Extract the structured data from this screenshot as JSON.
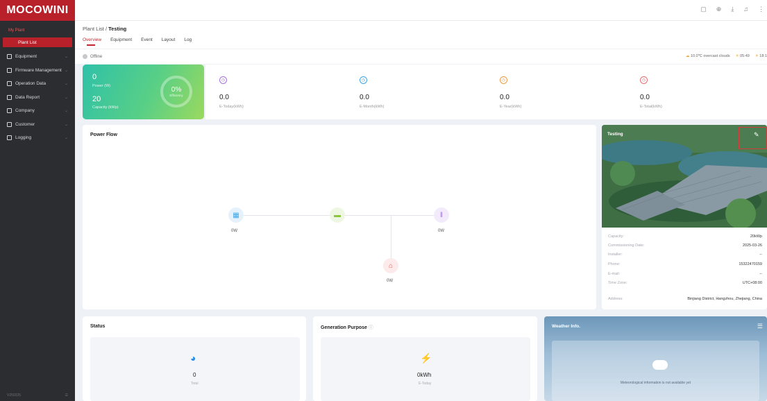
{
  "sidebar": {
    "logo": "MOCOWINI",
    "section": "My Plant",
    "active_item": "Plant List",
    "items": [
      {
        "label": "Equipment",
        "icon": "equipment-icon"
      },
      {
        "label": "Firmware Management",
        "icon": "firmware-icon"
      },
      {
        "label": "Operation Data",
        "icon": "operation-data-icon"
      },
      {
        "label": "Data Report",
        "icon": "report-icon"
      },
      {
        "label": "Company",
        "icon": "company-icon"
      },
      {
        "label": "Customer",
        "icon": "customer-icon"
      },
      {
        "label": "Logging",
        "icon": "logging-icon"
      }
    ],
    "version": "V250325"
  },
  "header": {
    "breadcrumb_parent": "Plant List",
    "breadcrumb_sep": " / ",
    "breadcrumb_current": "Testing",
    "tabs": [
      "Overview",
      "Equipment",
      "Event",
      "Layout",
      "Log"
    ]
  },
  "status": {
    "offline_label": "Offline",
    "weather_text": "10.0℃ overcast clouds",
    "sunrise": "05:49",
    "sunset": "18:1"
  },
  "kpi": {
    "power_value": "0",
    "power_label": "Power (W)",
    "capacity_value": "20",
    "capacity_label": "Capacity (kWp)",
    "efficiency_value": "0%",
    "efficiency_label": "Efficiency",
    "cells": [
      {
        "value": "0.0",
        "label": "E-Today(kWh)",
        "color": "#a56fe0"
      },
      {
        "value": "0.0",
        "label": "E-Month(kWh)",
        "color": "#3aa6e8"
      },
      {
        "value": "0.0",
        "label": "E-Year(kWh)",
        "color": "#f29a3a"
      },
      {
        "value": "0.0",
        "label": "E-Total(kWh)",
        "color": "#ef6b6b"
      }
    ]
  },
  "power_flow": {
    "title": "Power Flow",
    "pv": "0W",
    "grid": "0W",
    "load": "0W"
  },
  "plant": {
    "name": "Testing",
    "rows": [
      {
        "key": "Capacity:",
        "value": "20kWp"
      },
      {
        "key": "Commissioning Date:",
        "value": "2025-03-26"
      },
      {
        "key": "Installer:",
        "value": "--"
      },
      {
        "key": "Phone:",
        "value": "15322470159"
      },
      {
        "key": "E-mail:",
        "value": "--"
      },
      {
        "key": "Time Zone:",
        "value": "UTC+08:00"
      },
      {
        "key": "Address:",
        "value": "Binjiang District, Hangzhou, Zhejiang, China"
      }
    ]
  },
  "status_card": {
    "title": "Status",
    "value": "0",
    "label": "Total"
  },
  "generation_card": {
    "title": "Generation Purpose",
    "value": "0kWh",
    "label": "E-Today"
  },
  "weather_card": {
    "title": "Weather Info.",
    "message": "Meteorological information is not available yet"
  },
  "colors": {
    "brand": "#b8202a",
    "sidebar_bg": "#2b2d31",
    "pv": "#3aa6e8",
    "battery": "#8cc63f",
    "grid": "#a56fe0",
    "load": "#ef5b5b"
  }
}
